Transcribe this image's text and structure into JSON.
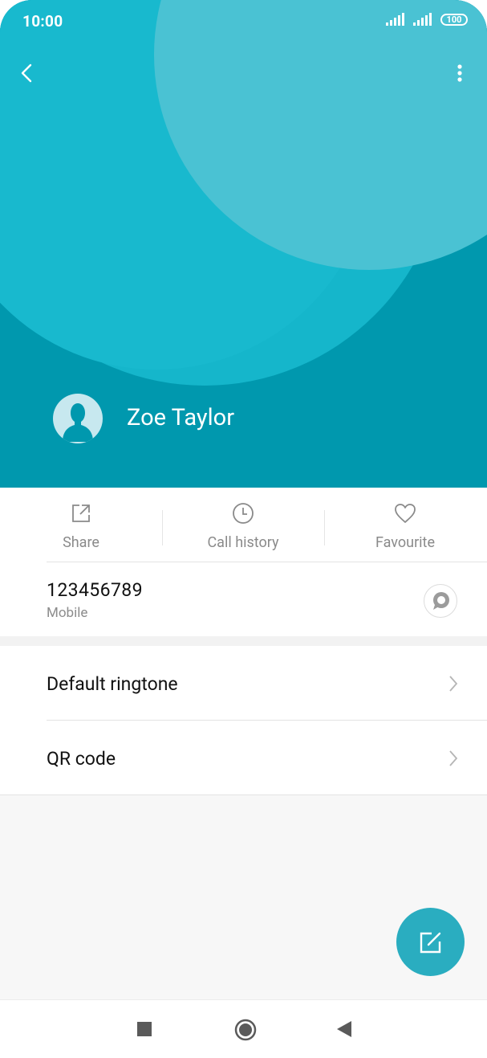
{
  "status_bar": {
    "time": "10:00",
    "battery": "100",
    "signal_icons": [
      "signal-icon",
      "signal-icon"
    ]
  },
  "header": {
    "back_icon": "chevron-left-icon",
    "more_icon": "more-vertical-icon",
    "contact_name": "Zoe Taylor",
    "avatar_icon": "person-silhouette-icon",
    "colors": {
      "base": "#0098ae",
      "circle_large": "#17b7cc",
      "circle_light": "#46c0d2"
    }
  },
  "actions": [
    {
      "label": "Share",
      "icon": "share-icon"
    },
    {
      "label": "Call history",
      "icon": "clock-icon"
    },
    {
      "label": "Favourite",
      "icon": "heart-icon"
    }
  ],
  "phone": {
    "number": "123456789",
    "type": "Mobile",
    "message_icon": "message-bubble-icon"
  },
  "menu": [
    {
      "label": "Default ringtone"
    },
    {
      "label": "QR code"
    }
  ],
  "fab": {
    "icon": "edit-icon",
    "color": "#2aadc0"
  },
  "navbar": [
    "recents-square-icon",
    "home-circle-icon",
    "back-triangle-icon"
  ]
}
